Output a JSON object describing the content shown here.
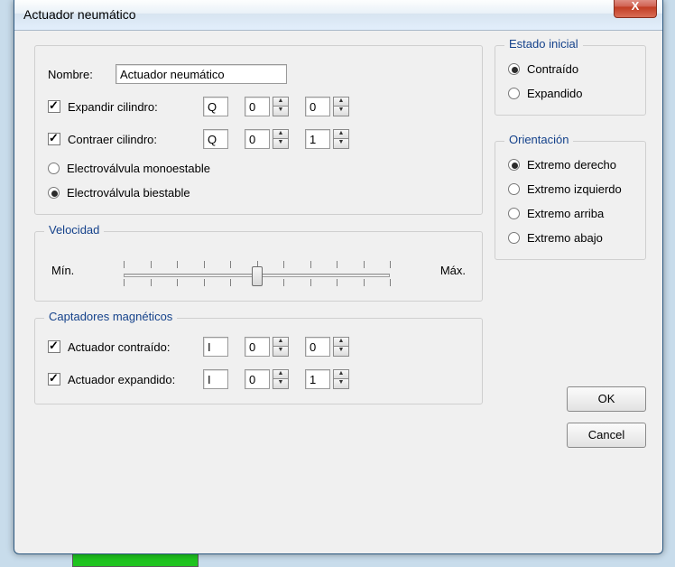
{
  "window": {
    "title": "Actuador neumático",
    "close_icon": "X"
  },
  "name_field": {
    "label": "Nombre:",
    "value": "Actuador neumático"
  },
  "expand": {
    "label": "Expandir cilindro:",
    "checked": true,
    "letter": "Q",
    "v1": "0",
    "v2": "0"
  },
  "contract": {
    "label": "Contraer cilindro:",
    "checked": true,
    "letter": "Q",
    "v1": "0",
    "v2": "1"
  },
  "valve": {
    "mono": "Electroválvula monoestable",
    "bi": "Electroválvula biestable",
    "selected": "bi"
  },
  "velocity": {
    "legend": "Velocidad",
    "min": "Mín.",
    "max": "Máx.",
    "pos_pct": 50
  },
  "captadores": {
    "legend": "Captadores magnéticos",
    "contraido": {
      "label": "Actuador contraído:",
      "checked": true,
      "letter": "I",
      "v1": "0",
      "v2": "0"
    },
    "expandido": {
      "label": "Actuador expandido:",
      "checked": true,
      "letter": "I",
      "v1": "0",
      "v2": "1"
    }
  },
  "estado": {
    "legend": "Estado inicial",
    "contraido": "Contraído",
    "expandido": "Expandido",
    "selected": "contraido"
  },
  "orientacion": {
    "legend": "Orientación",
    "opts": {
      "derecho": "Extremo derecho",
      "izquierdo": "Extremo izquierdo",
      "arriba": "Extremo arriba",
      "abajo": "Extremo abajo"
    },
    "selected": "derecho"
  },
  "buttons": {
    "ok": "OK",
    "cancel": "Cancel"
  }
}
